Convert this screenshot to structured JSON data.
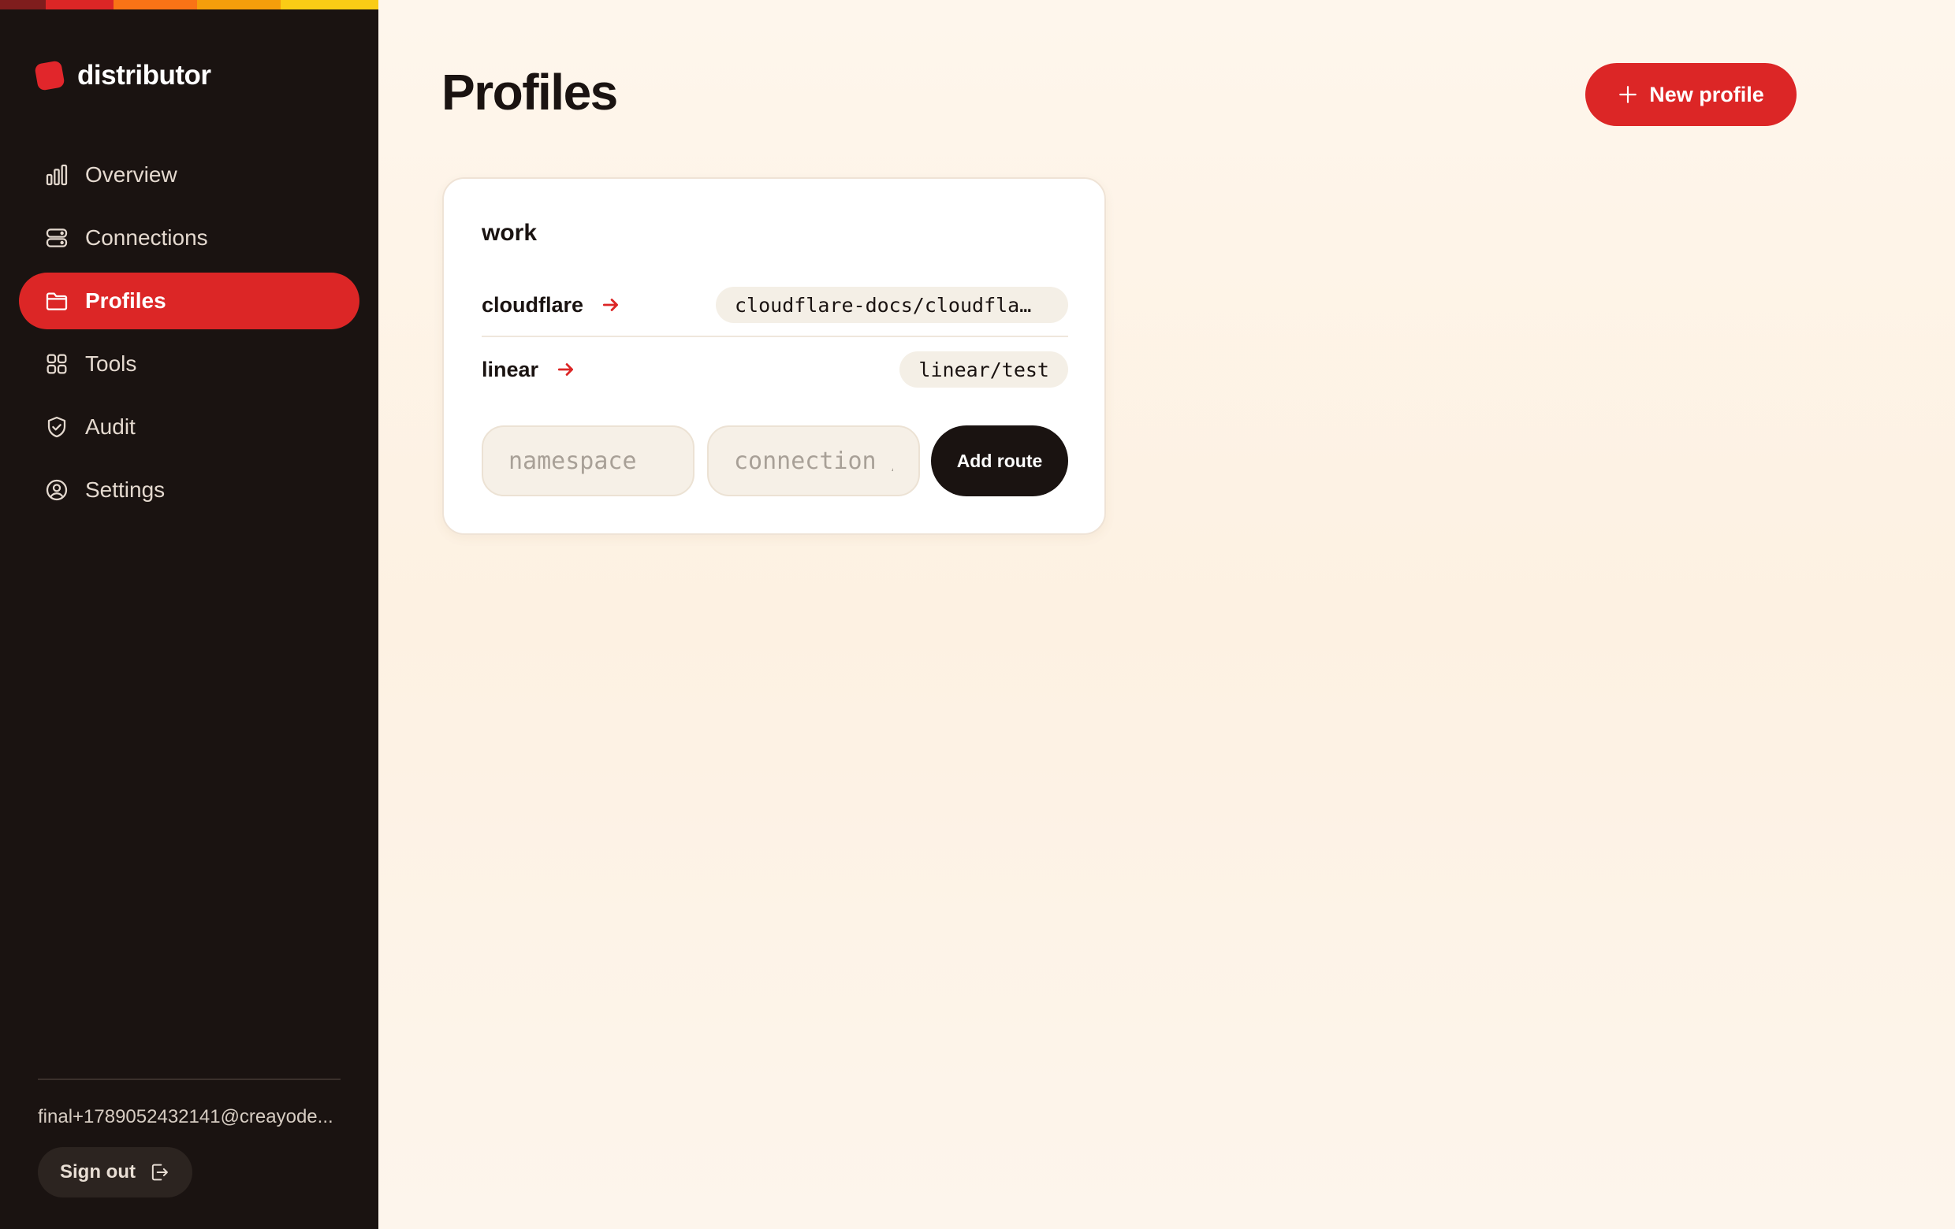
{
  "brand": {
    "name": "distributor"
  },
  "colors": {
    "accent": "#dc2626",
    "sidebar_bg": "#1a1311",
    "stripe": [
      "#7f1d1d",
      "#dc2626",
      "#f97316",
      "#f59e0b",
      "#facc15"
    ]
  },
  "sidebar": {
    "items": [
      {
        "label": "Overview",
        "icon": "bar-chart-icon",
        "active": false
      },
      {
        "label": "Connections",
        "icon": "database-icon",
        "active": false
      },
      {
        "label": "Profiles",
        "icon": "folder-icon",
        "active": true
      },
      {
        "label": "Tools",
        "icon": "grid-icon",
        "active": false
      },
      {
        "label": "Audit",
        "icon": "shield-check-icon",
        "active": false
      },
      {
        "label": "Settings",
        "icon": "user-circle-icon",
        "active": false
      }
    ],
    "user_email": "final+1789052432141@creayode...",
    "sign_out_label": "Sign out"
  },
  "header": {
    "title": "Profiles",
    "new_profile_label": "New profile"
  },
  "profile_card": {
    "name": "work",
    "routes": [
      {
        "namespace": "cloudflare",
        "target": "cloudflare-docs/cloudfla…"
      },
      {
        "namespace": "linear",
        "target": "linear/test"
      }
    ],
    "namespace_placeholder": "namespace",
    "connection_placeholder": "connection / tool",
    "add_route_label": "Add route"
  }
}
